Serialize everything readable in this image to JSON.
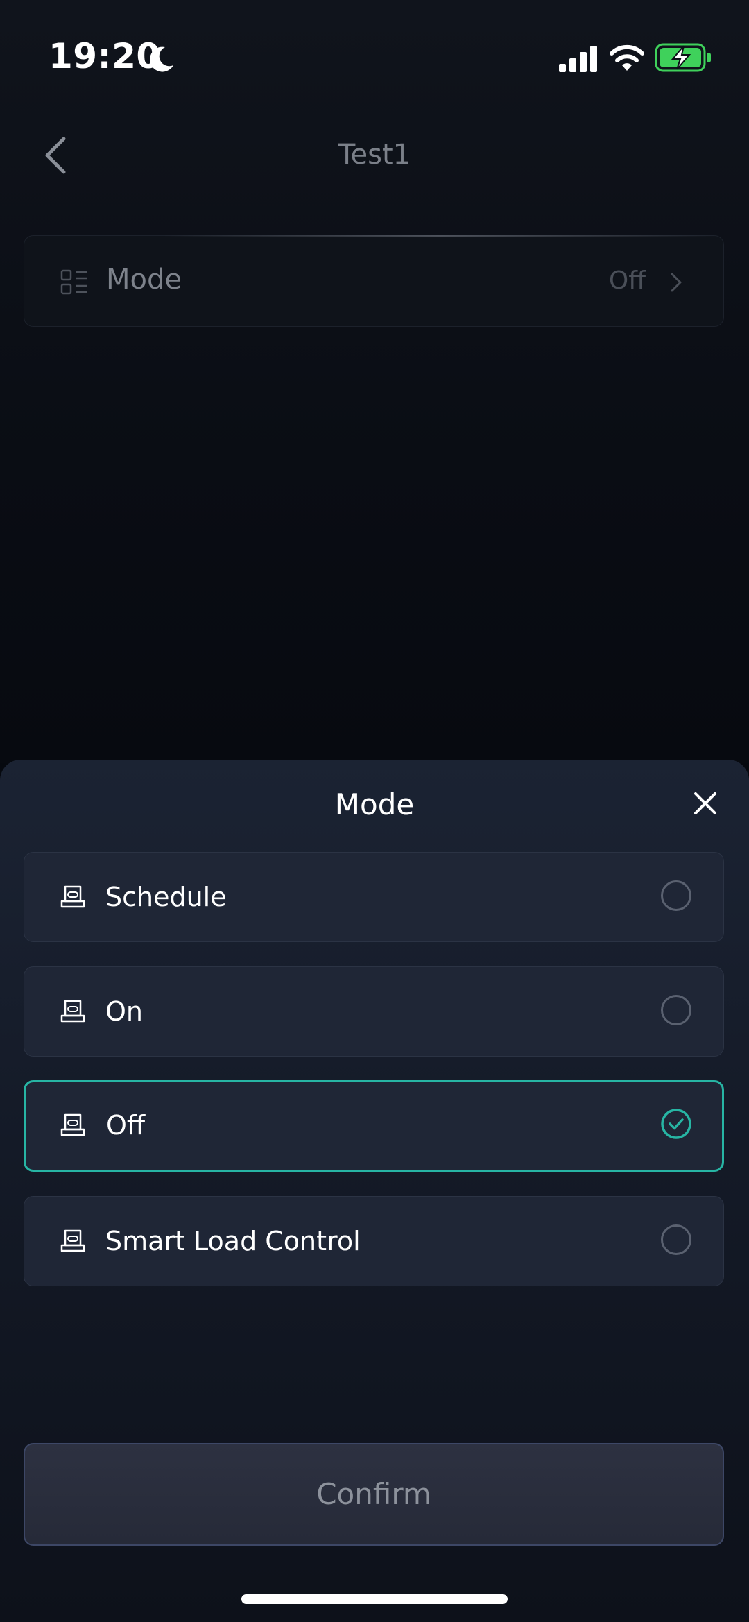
{
  "status_bar": {
    "time": "19:20",
    "icons": [
      "moon-icon",
      "signal-icon",
      "wifi-icon",
      "battery-charging-icon"
    ],
    "battery_color": "#3fd15b"
  },
  "header": {
    "title": "Test1",
    "back_icon": "chevron-left-icon"
  },
  "mode_row": {
    "label": "Mode",
    "value": "Off",
    "icon": "list-icon"
  },
  "sheet": {
    "title": "Mode",
    "close_icon": "close-icon",
    "accent_color": "#27b5a4",
    "options": [
      {
        "label": "Schedule",
        "selected": false,
        "icon": "device-icon"
      },
      {
        "label": "On",
        "selected": false,
        "icon": "device-icon"
      },
      {
        "label": "Off",
        "selected": true,
        "icon": "device-icon"
      },
      {
        "label": "Smart Load Control",
        "selected": false,
        "icon": "device-icon"
      }
    ],
    "confirm_label": "Confirm"
  }
}
